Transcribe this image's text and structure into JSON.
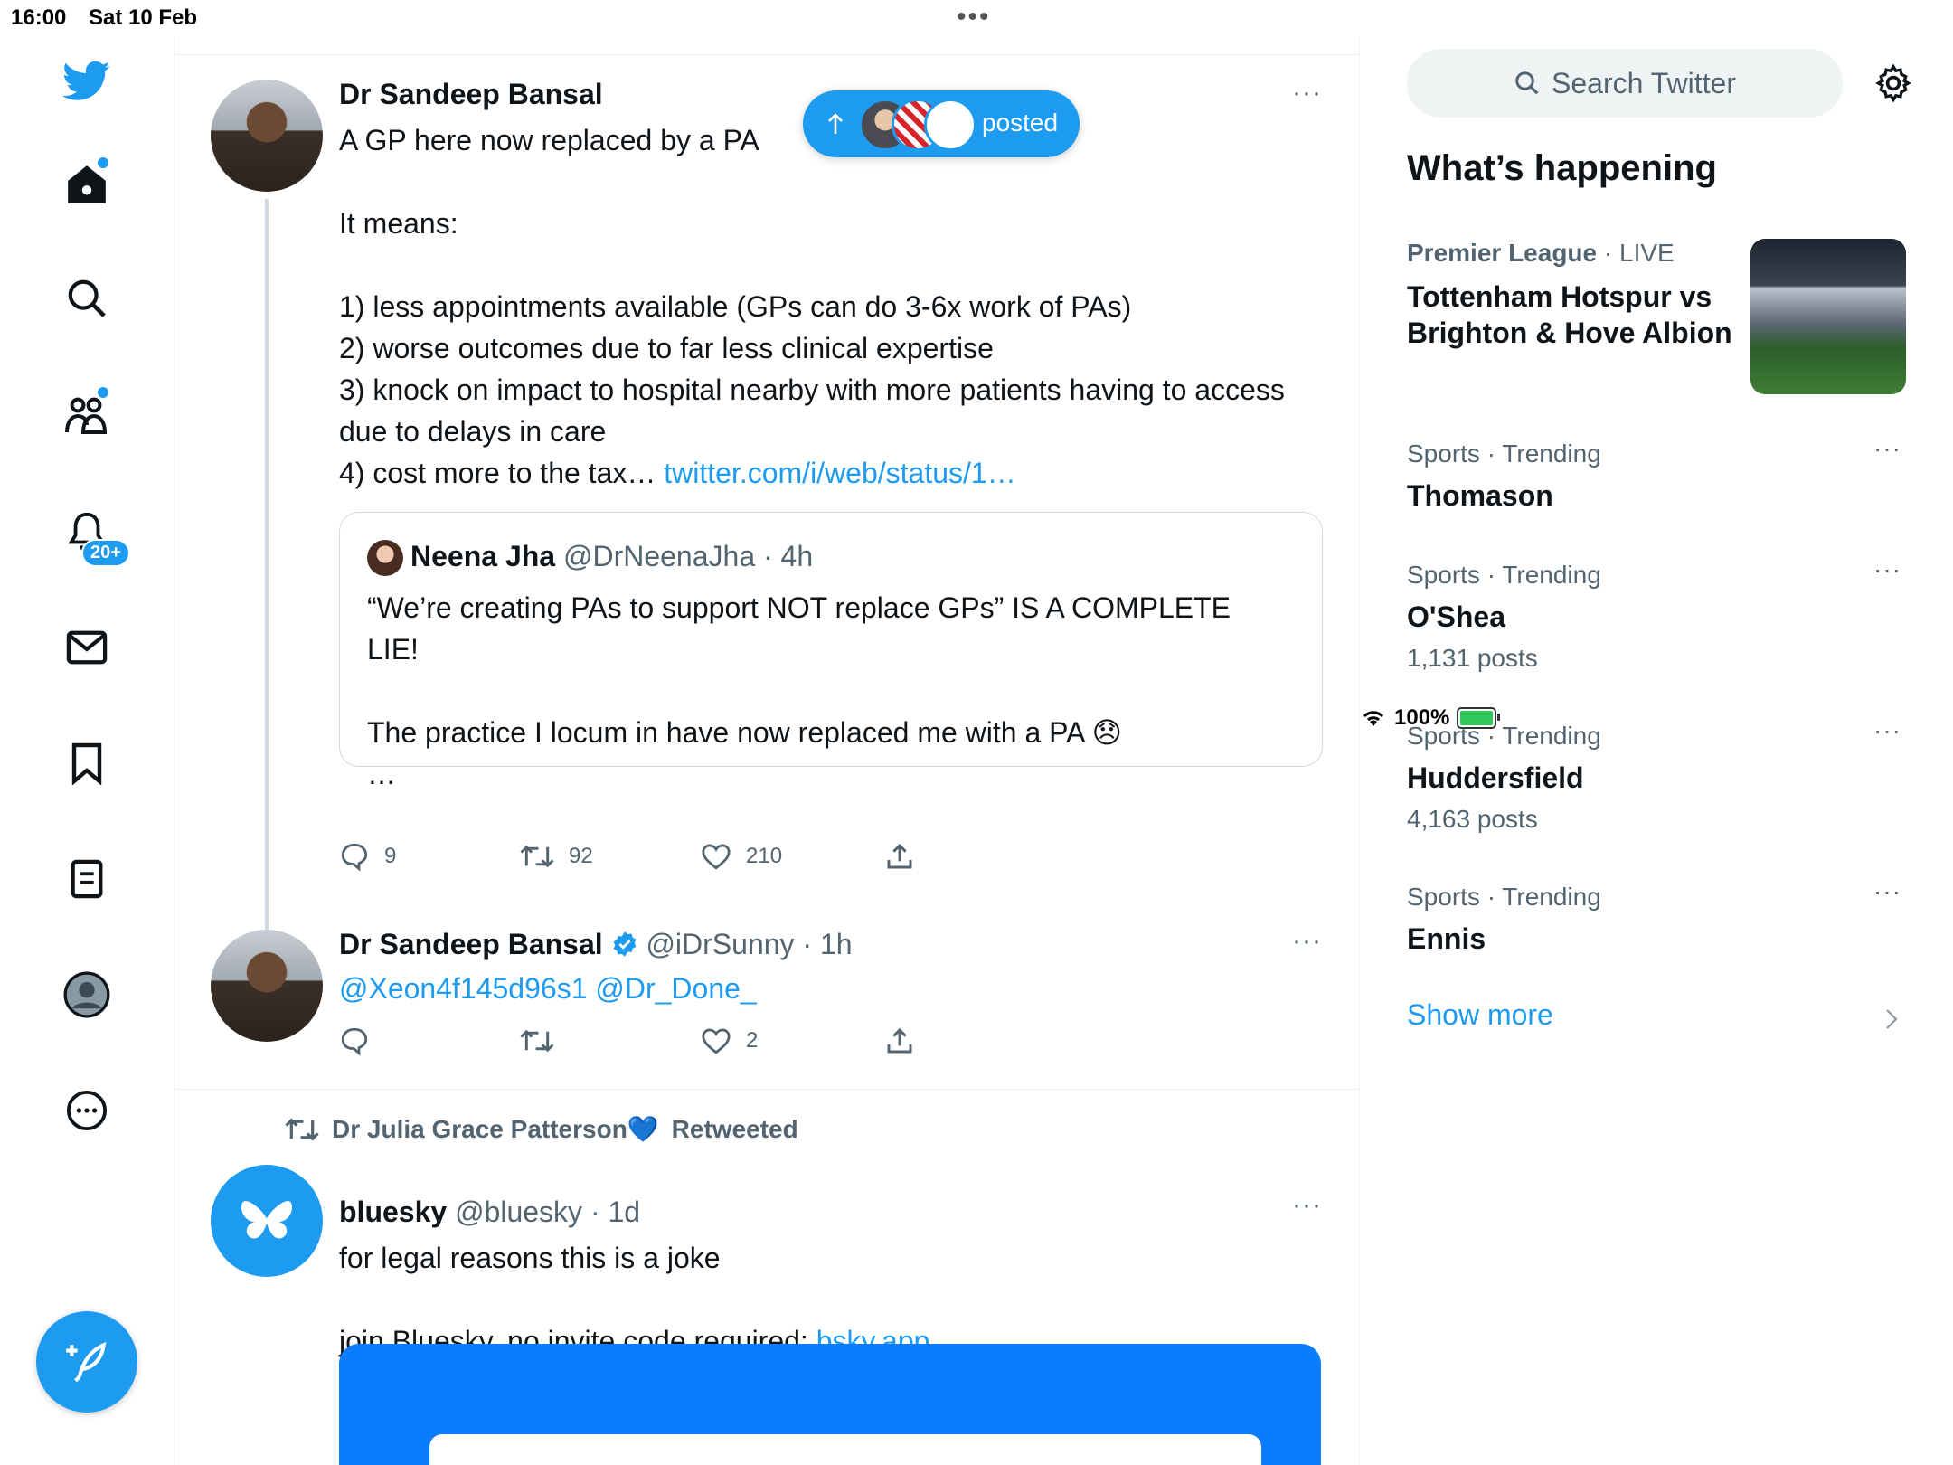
{
  "status_bar": {
    "time": "16:00",
    "date": "Sat 10 Feb",
    "dots": "•••",
    "battery": "100%"
  },
  "nav": {
    "notifications_badge": "20+"
  },
  "new_posts_pill": {
    "label": "posted"
  },
  "tweets": [
    {
      "name": "Dr Sandeep Bansal",
      "text": "A GP here now replaced by a PA\n\nIt means:\n\n1) less appointments available (GPs can do 3-6x work of PAs)\n2) worse outcomes due to far less clinical expertise\n3) knock on impact to hospital nearby with more patients having to access due to delays in care\n4) cost more to the tax… ",
      "link": "twitter.com/i/web/status/1…",
      "more": "···",
      "quote": {
        "name": "Neena Jha",
        "handle": "@DrNeenaJha",
        "time": "· 4h",
        "text": "“We’re creating PAs to support NOT replace GPs” IS A COMPLETE LIE!\n\nThe practice I locum in have now replaced me with a PA 😞\n…"
      },
      "replies": "9",
      "retweets": "92",
      "likes": "210"
    },
    {
      "name": "Dr Sandeep Bansal",
      "handle": "@iDrSunny",
      "time": "· 1h",
      "mentions": "@Xeon4f145d96s1 @Dr_Done_",
      "more": "···",
      "replies": "",
      "retweets": "",
      "likes": "2"
    },
    {
      "retweeted_by": "Dr Julia Grace Patterson💙",
      "retweeted_label": "Retweeted",
      "name": "bluesky",
      "handle": "@bluesky",
      "time": "· 1d",
      "text": "for legal reasons this is a joke\n\njoin Bluesky, no invite code required: ",
      "link": "bsky.app",
      "more": "···"
    }
  ],
  "sidebar": {
    "search_placeholder": "Search Twitter",
    "section_title": "What’s happening",
    "trends": [
      {
        "category": "Premier League",
        "qualifier": "· LIVE",
        "title": "Tottenham Hotspur vs Brighton & Hove Albion",
        "count": ""
      },
      {
        "category": "Sports · Trending",
        "qualifier": "",
        "title": "Thomason",
        "count": ""
      },
      {
        "category": "Sports · Trending",
        "qualifier": "",
        "title": "O'Shea",
        "count": "1,131 posts"
      },
      {
        "category": "Sports · Trending",
        "qualifier": "",
        "title": "Huddersfield",
        "count": "4,163 posts"
      },
      {
        "category": "Sports · Trending",
        "qualifier": "",
        "title": "Ennis",
        "count": ""
      }
    ],
    "show_more": "Show more",
    "trend_more": "···"
  },
  "colors": {
    "accent": "#1d9bf0",
    "text": "#0f1419",
    "secondary": "#536471"
  }
}
